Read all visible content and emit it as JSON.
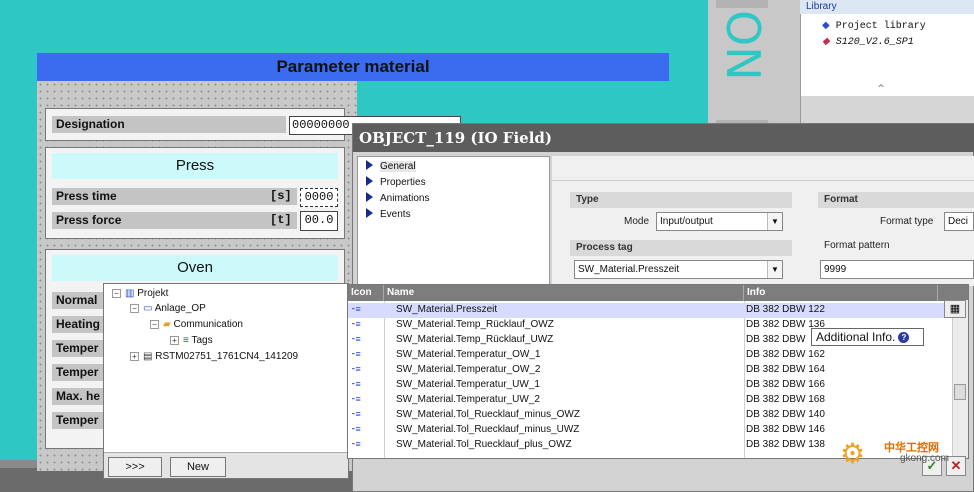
{
  "parameter_screen": {
    "title": "Parameter material",
    "designation_label": "Designation",
    "designation_value": "00000000",
    "press": {
      "title": "Press",
      "rows": [
        {
          "label": "Press time",
          "unit": "[s]",
          "value": "0000"
        },
        {
          "label": "Press force",
          "unit": "[t]",
          "value": "00.0"
        }
      ]
    },
    "oven": {
      "title": "Oven",
      "rows": [
        {
          "label": "Normal"
        },
        {
          "label": "Heating"
        },
        {
          "label": "Temper"
        },
        {
          "label": "Temper"
        },
        {
          "label": "Max. he"
        },
        {
          "label": "Temper"
        }
      ]
    },
    "side_text": "ON"
  },
  "library": {
    "header": "Library",
    "items": [
      {
        "label": "Project library",
        "icon": "project-library-icon"
      },
      {
        "label": "S120_V2.6_SP1",
        "icon": "library-cube-icon"
      }
    ]
  },
  "object_dialog": {
    "title": "OBJECT_119 (IO Field)",
    "nav": [
      "General",
      "Properties",
      "Animations",
      "Events"
    ],
    "type_group": {
      "title": "Type",
      "mode_label": "Mode",
      "mode_value": "Input/output"
    },
    "process_tag_group": {
      "title": "Process tag",
      "value": "SW_Material.Presszeit"
    },
    "format_group": {
      "title": "Format",
      "format_type_label": "Format type",
      "format_type_value": "Deci",
      "format_pattern_label": "Format pattern",
      "format_pattern_value": "9999"
    }
  },
  "tag_tree": {
    "items": [
      {
        "label": "Projekt",
        "level": 0,
        "expander": "−",
        "icon": "project-icon"
      },
      {
        "label": "Anlage_OP",
        "level": 1,
        "expander": "−",
        "icon": "hmi-device-icon"
      },
      {
        "label": "Communication",
        "level": 2,
        "expander": "−",
        "icon": "communication-folder-icon"
      },
      {
        "label": "Tags",
        "level": 3,
        "expander": "+",
        "icon": "tags-icon"
      },
      {
        "label": "RSTM02751_1761CN4_141209",
        "level": 1,
        "expander": "+",
        "icon": "plc-icon"
      }
    ],
    "buttons": [
      ">>>",
      "New"
    ]
  },
  "tag_table": {
    "columns": [
      "Icon",
      "Name",
      "Info"
    ],
    "rows": [
      {
        "name": "SW_Material.Presszeit",
        "info": "DB 382 DBW 122",
        "selected": true
      },
      {
        "name": "SW_Material.Temp_Rücklauf_OWZ",
        "info": "DB 382 DBW 136"
      },
      {
        "name": "SW_Material.Temp_Rücklauf_UWZ",
        "info": "DB 382 DBW"
      },
      {
        "name": "SW_Material.Temperatur_OW_1",
        "info": "DB 382 DBW 162"
      },
      {
        "name": "SW_Material.Temperatur_OW_2",
        "info": "DB 382 DBW 164"
      },
      {
        "name": "SW_Material.Temperatur_UW_1",
        "info": "DB 382 DBW 166"
      },
      {
        "name": "SW_Material.Temperatur_UW_2",
        "info": "DB 382 DBW 168"
      },
      {
        "name": "SW_Material.Tol_Ruecklauf_minus_OWZ",
        "info": "DB 382 DBW 140"
      },
      {
        "name": "SW_Material.Tol_Ruecklauf_minus_UWZ",
        "info": "DB 382 DBW 146"
      },
      {
        "name": "SW_Material.Tol_Ruecklauf_plus_OWZ",
        "info": "DB 382 DBW 138"
      }
    ],
    "tooltip": "Additional Info."
  },
  "watermark": {
    "cn": "中华工控网",
    "url": "gkong.com"
  },
  "colors": {
    "hmi_background": "#2ec7c4",
    "title_bar": "#3b6cf0",
    "section_header": "#ccfafa",
    "dialog_title": "#5d5d5d",
    "selected_row": "#d7dbff"
  }
}
